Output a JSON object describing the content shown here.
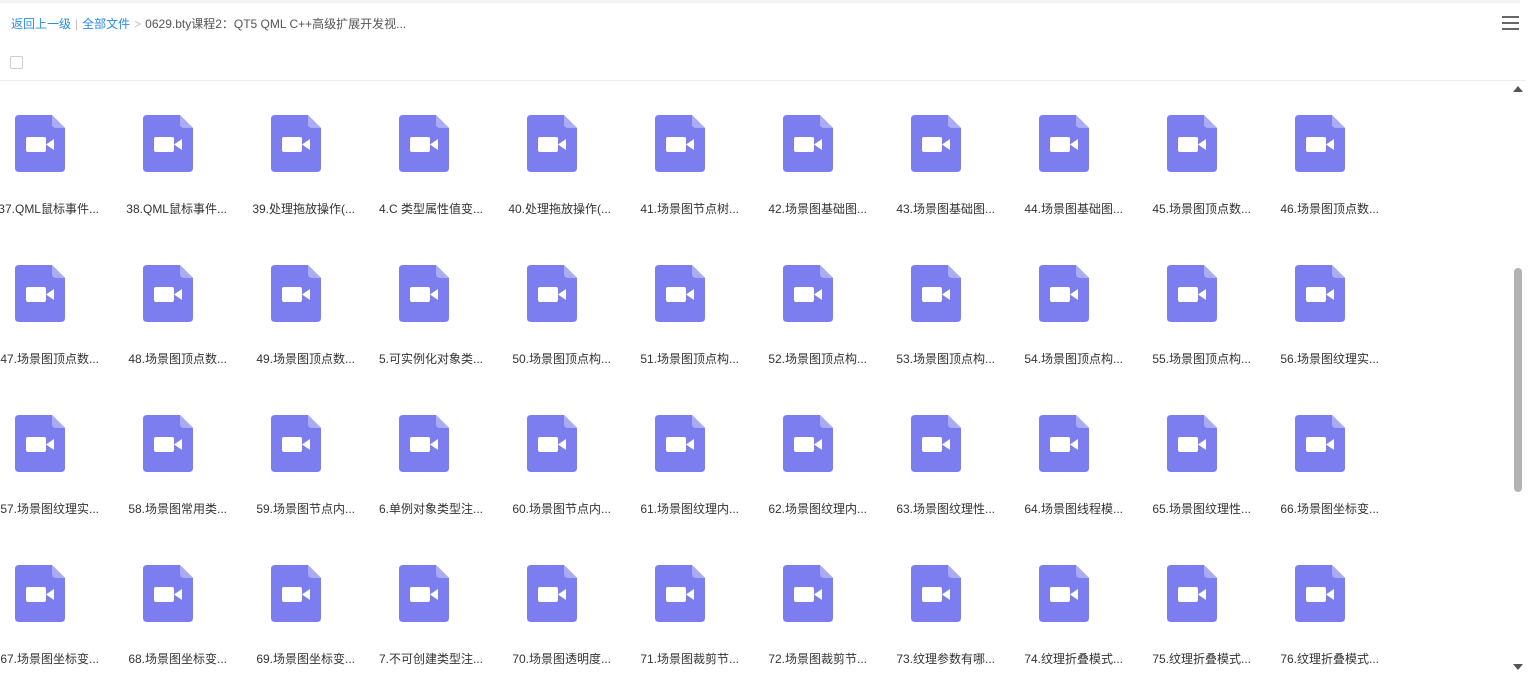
{
  "breadcrumb": {
    "back_label": "返回上一级",
    "divider": "|",
    "all_files_label": "全部文件",
    "arrow": ">",
    "current_folder": "0629.bty课程2：QT5 QML C++高级扩展开发视..."
  },
  "colors": {
    "icon_purple": "#7c7ef0",
    "icon_fold": "#a9abf6",
    "link_blue": "#2a8de8"
  },
  "files": [
    {
      "name": "37.QML鼠标事件..."
    },
    {
      "name": "38.QML鼠标事件..."
    },
    {
      "name": "39.处理拖放操作(..."
    },
    {
      "name": "4.C 类型属性值变..."
    },
    {
      "name": "40.处理拖放操作(..."
    },
    {
      "name": "41.场景图节点树..."
    },
    {
      "name": "42.场景图基础图..."
    },
    {
      "name": "43.场景图基础图..."
    },
    {
      "name": "44.场景图基础图..."
    },
    {
      "name": "45.场景图顶点数..."
    },
    {
      "name": "46.场景图顶点数..."
    },
    {
      "name": "47.场景图顶点数..."
    },
    {
      "name": "48.场景图顶点数..."
    },
    {
      "name": "49.场景图顶点数..."
    },
    {
      "name": "5.可实例化对象类..."
    },
    {
      "name": "50.场景图顶点构..."
    },
    {
      "name": "51.场景图顶点构..."
    },
    {
      "name": "52.场景图顶点构..."
    },
    {
      "name": "53.场景图顶点构..."
    },
    {
      "name": "54.场景图顶点构..."
    },
    {
      "name": "55.场景图顶点构..."
    },
    {
      "name": "56.场景图纹理实..."
    },
    {
      "name": "57.场景图纹理实..."
    },
    {
      "name": "58.场景图常用类..."
    },
    {
      "name": "59.场景图节点内..."
    },
    {
      "name": "6.单例对象类型注..."
    },
    {
      "name": "60.场景图节点内..."
    },
    {
      "name": "61.场景图纹理内..."
    },
    {
      "name": "62.场景图纹理内..."
    },
    {
      "name": "63.场景图纹理性..."
    },
    {
      "name": "64.场景图线程模..."
    },
    {
      "name": "65.场景图纹理性..."
    },
    {
      "name": "66.场景图坐标变..."
    },
    {
      "name": "67.场景图坐标变..."
    },
    {
      "name": "68.场景图坐标变..."
    },
    {
      "name": "69.场景图坐标变..."
    },
    {
      "name": "7.不可创建类型注..."
    },
    {
      "name": "70.场景图透明度..."
    },
    {
      "name": "71.场景图裁剪节..."
    },
    {
      "name": "72.场景图裁剪节..."
    },
    {
      "name": "73.纹理参数有哪..."
    },
    {
      "name": "74.纹理折叠模式..."
    },
    {
      "name": "75.纹理折叠模式..."
    },
    {
      "name": "76.纹理折叠模式..."
    }
  ]
}
